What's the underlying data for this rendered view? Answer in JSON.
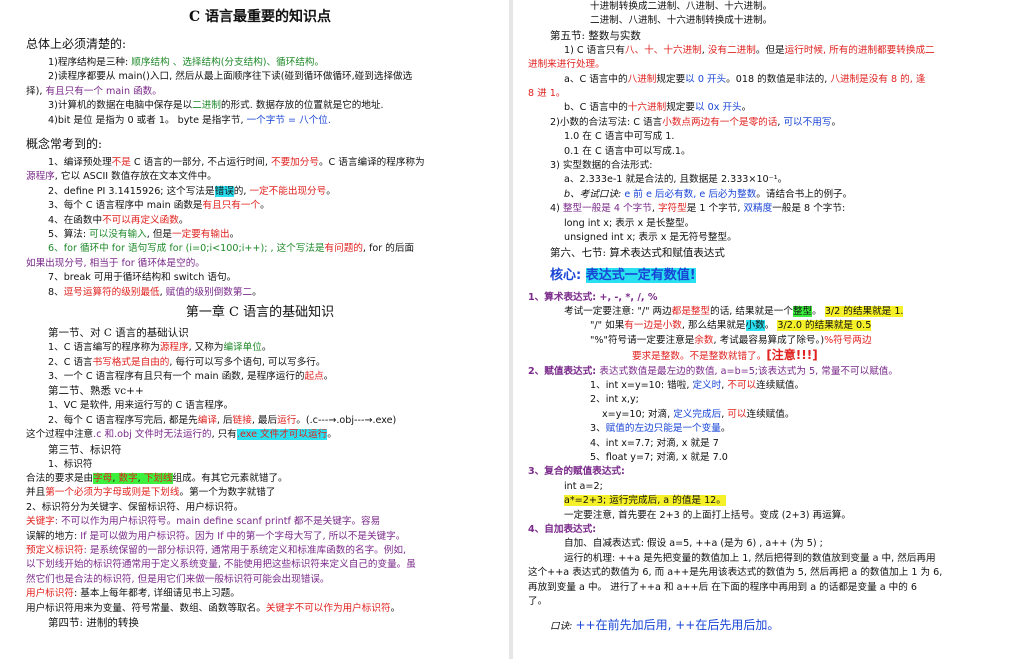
{
  "left": {
    "title": "C 语言最重要的知识点",
    "overview": {
      "heading": "总体上必须清楚的:",
      "l1": [
        "1)程序结构是三种: ",
        "顺序结构 、选择结构(分支结构)、循环结构。"
      ],
      "l2a": "2)读程序都要从 main()入口, 然后从最上面顺序往下读(碰到循环做循环,碰到选择做选",
      "l2b": [
        "择), ",
        "有且只有一个 main 函数。"
      ],
      "l3": [
        "3)计算机的数据在电脑中保存是以",
        "二进制",
        "的形式. 数据存放的位置就是它的地址."
      ],
      "l4": [
        "4)bit 是位 是指为 0 或者 1。 byte 是指字节, ",
        "一个字节 = 八个位."
      ]
    },
    "concepts": {
      "heading": "概念常考到的:",
      "c1a": [
        "1、编译预处理",
        "不是",
        " C 语言的一部分, 不占运行时间, ",
        "不要加分号",
        "。C 语言编译的程序称为"
      ],
      "c1b": [
        "源程序",
        ", 它以 ASCII 数值存放在文本文件中。"
      ],
      "c2": [
        "2、define PI 3.1415926;  这个写法是",
        "错误",
        "的, ",
        "一定不能出现分号",
        "。"
      ],
      "c3": [
        "3、每个 C 语言程序中 main 函数是",
        "有且只有一个",
        "。"
      ],
      "c4": [
        "4、在函数中",
        "不可以再定义函数",
        "。"
      ],
      "c5": [
        "5、算法: ",
        "可以没有输入",
        ", 但是",
        "一定要有输出",
        "。"
      ],
      "c6a": [
        "6、for 循环中 for 语句写成 for (i=0;i<100;i++); , 这个写法是",
        "有问题的",
        ", for 的后面"
      ],
      "c6b": "如果出现分号, 相当于 for 循环体是空的。",
      "c7": [
        "7、break 可用于循环结构和 switch 语句。"
      ],
      "c8": [
        "8、",
        "逗号运算符的级别最低",
        ", ",
        "赋值的级别倒数第二",
        "。"
      ]
    },
    "chapter1": {
      "heading": "第一章 C 语言的基础知识",
      "s1": "第一节、对 C 语言的基础认识",
      "s1l1": [
        "1、C 语言编写的程序称为",
        "源程序",
        ", 又称为",
        "编译单位",
        "。"
      ],
      "s1l2": [
        "2、C 语言",
        "书写格式是自由的",
        ", 每行可以写多个语句, 可以写多行。"
      ],
      "s1l3": [
        "3、一个 C 语言程序有且只有一个 main 函数, 是程序运行的",
        "起点",
        "。"
      ],
      "s2": "第二节、熟悉 vc++",
      "s2l1": "1、VC 是软件, 用来运行写的 C 语言程序。",
      "s2l2": [
        "2、每个 C 语言程序写完后, 都是先",
        "编译",
        ", 后",
        "链接",
        ", 最后",
        "运行",
        "。(.c---→.obj---→.exe)"
      ],
      "s2l3": [
        "这个过程中注意",
        ".c 和.obj 文件时无法运行的",
        ", 只有",
        ".exe 文件才可以运行",
        "。"
      ],
      "s3": "第三节、标识符",
      "s3l1": "1、标识符",
      "s3l2": [
        "合法的要求是由",
        "字母",
        ", ",
        "数字",
        ", ",
        "下划线",
        "组成。有其它元素就错了。"
      ],
      "s3l3": [
        "并且",
        "第一个必须为字母或则是下划线",
        "。第一个为数字就错了"
      ],
      "s3l4": "2、标识符分为关键字、保留标识符、用户标识符。",
      "s3l5a": [
        "关键字",
        ": 不可以作为用户标识符号。main  define  scanf  printf 都不是关键字。容易"
      ],
      "s3l5b": [
        "误解的地方: ",
        "If 是可以做为用户标识符",
        "。因为 If 中的第一个字母大写了, 所以不是关键字。"
      ],
      "s3l6a": [
        "预定义标识符",
        ": 是系统保留的一部分标识符, 通常用于系统定义和标准库函数的名字。例如,"
      ],
      "s3l6b": "以下划线开始的标识符通常用于定义系统变量, 不能使用把这些标识符来定义自己的变量。虽",
      "s3l6c": "然它们也是合法的标识符, 但是用它们来做一般标识符可能会出现错误。",
      "s3l7": [
        "用户标识符",
        ": 基本上每年都考, 详细请见书上习题。"
      ],
      "s3l8": [
        "用户标识符用来为变量、符号常量、数组、函数等取名。",
        "关键字不可以作为用户标识符",
        "。"
      ],
      "s4": "第四节: 进制的转换"
    }
  },
  "right": {
    "t1": "十进制转换成二进制、八进制、十六进制。",
    "t2": "二进制、八进制、十六进制转换成十进制。",
    "s5": "第五节: 整数与实数",
    "r1a": [
      "1) C 语言只有",
      "八、十、十六进制",
      ", ",
      "没有二进制",
      "。但是",
      "运行时候, 所有的进制都要转换成二"
    ],
    "r1b": "进制来进行处理。",
    "r2a": [
      "a、C 语言中的",
      "八进制",
      "规定要",
      "以 0 开头",
      "。018 的数值是非法的, ",
      "八进制是没有 8 的, 逢"
    ],
    "r2b": "8 进 1。",
    "r3": [
      "b、C 语言中的",
      "十六进制",
      "规定要",
      "以 0x 开头",
      "。"
    ],
    "r4": [
      "2)小数的合法写法: C 语言",
      "小数点两边有一个是零的话",
      ", ",
      "可以不用写",
      "。"
    ],
    "r5": "1.0 在 C 语言中可写成 1.",
    "r6": "0.1 在 C 语言中可以写成.1。",
    "r7": "3) 实型数据的合法形式:",
    "r8": "a、2.333e-1 就是合法的, 且数据是 2.333×10⁻¹。",
    "r9": [
      "b、考试口诀: ",
      "e 前 e 后必有数, e 后必为整数",
      "。请结合书上的例子。"
    ],
    "r10": [
      "4) ",
      "整型一般是 4 个字节",
      ", ",
      "字符型",
      "是 1 个字节, ",
      "双精度",
      "一般是 8 个字节:"
    ],
    "r11": "long int x; 表示 x 是长整型。",
    "r12": "unsigned int x; 表示 x 是无符号整型。",
    "s67": "第六、七节: 算术表达式和赋值表达式",
    "core": [
      "核心: ",
      "表达式一定有数值!"
    ],
    "e1": "1、算术表达式: +, -, *, /, %",
    "e2": [
      "考试一定要注意: \"/\" 两边",
      "都是整型",
      "的话, 结果就是一个",
      "整型",
      "。 ",
      "3/2 的结果就是 1."
    ],
    "e3": [
      "\"/\" 如果",
      "有一边是小数",
      ", 那么结果就是",
      "小数",
      "。 ",
      "3/2.0 的结果就是 0.5"
    ],
    "e4": [
      "\"%\"符号请一定要注意是",
      "余数",
      ", 考试最容易算成了除号。)",
      "%符号两边"
    ],
    "e5": [
      "要求是整数。不是整数就错了。",
      "[注意!!!]"
    ],
    "a1": [
      "2、赋值表达式: ",
      "表达式数值是最左边的数值, a=b=5;该表达式为 5, 常量不可以赋值。"
    ],
    "a2": [
      "1、int x=y=10: 错啦, ",
      "定义时",
      ", ",
      "不可以",
      "连续赋值。"
    ],
    "a3": "2、int x,y;",
    "a4": [
      "x=y=10;   对滴, ",
      "定义完成后",
      ", ",
      "可以",
      "连续赋值。"
    ],
    "a5": [
      "3、",
      "赋值的左边只能是一个变量",
      "。"
    ],
    "a6": "4、int x=7.7; 对滴, x 就是 7",
    "a7": "5、float y=7; 对滴, x 就是 7.0",
    "b1": "3、复合的赋值表达式:",
    "b2": "int a=2;",
    "b3": "a*=2+3; 运行完成后, a 的值是 12。",
    "b4": "一定要注意, 首先要在 2+3 的上面打上括号。变成 (2+3) 再运算。",
    "d1": "4、自加表达式:",
    "d2": "自加、自减表达式: 假设 a=5, ++a (是为 6) , a++ (为 5) ;",
    "d3": "运行的机理: ++a 是先把变量的数值加上 1, 然后把得到的数值放到变量 a 中, 然后再用",
    "d4": "这个++a 表达式的数值为 6, 而 a++是先用该表达式的数值为 5, 然后再把 a 的数值加上 1 为 6,",
    "d5": "再放到变量 a 中。 进行了++a 和 a++后 在下面的程序中再用到 a 的话都是变量 a 中的 6",
    "d6": "了。",
    "tip": [
      "口诀: ",
      "++在前先加后用, ++在后先用后加。"
    ]
  }
}
